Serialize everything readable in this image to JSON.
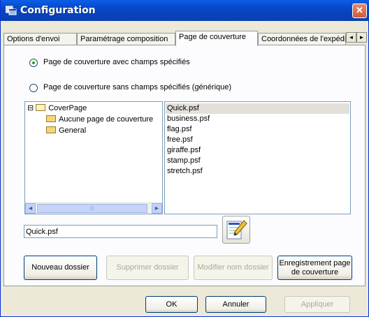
{
  "window": {
    "title": "Configuration",
    "close_glyph": "✕",
    "icon": "app-window-icon"
  },
  "tabs": [
    {
      "label": "Options d'envoi",
      "active": false
    },
    {
      "label": "Paramétrage composition",
      "active": false
    },
    {
      "label": "Page de couverture",
      "active": true
    },
    {
      "label": "Coordonnées de l'expéditeur",
      "active": false
    }
  ],
  "tab_scroll": {
    "left": "◄",
    "right": "►"
  },
  "options": {
    "with_fields": {
      "label": "Page de couverture avec champs spécifiés",
      "checked": true
    },
    "without_fields": {
      "label": "Page de couverture sans champs spécifiés (générique)",
      "checked": false
    }
  },
  "tree": {
    "expander": "⊟",
    "root": "CoverPage",
    "children": [
      "Aucune page de couverture",
      "General"
    ],
    "scroll_left": "◄",
    "scroll_right": "►",
    "scroll_grip": "|||"
  },
  "files": [
    "Quick.psf",
    "business.psf",
    "flag.psf",
    "free.psf",
    "giraffe.psf",
    "stamp.psf",
    "stretch.psf"
  ],
  "selected_file": "Quick.psf",
  "filename_value": "Quick.psf",
  "edit_icon": "edit-cover-page-icon",
  "buttons": {
    "new_folder": "Nouveau dossier",
    "delete_folder": "Supprimer dossier",
    "rename_folder": "Modifier nom dossier",
    "save_cover_line1": "Enregistrement page",
    "save_cover_line2": "de couverture",
    "ok": "OK",
    "cancel": "Annuler",
    "apply": "Appliquer"
  },
  "colors": {
    "title_bar": "#0a5fe6",
    "close_button": "#d25a3a",
    "selection": "#e2e0d8"
  }
}
